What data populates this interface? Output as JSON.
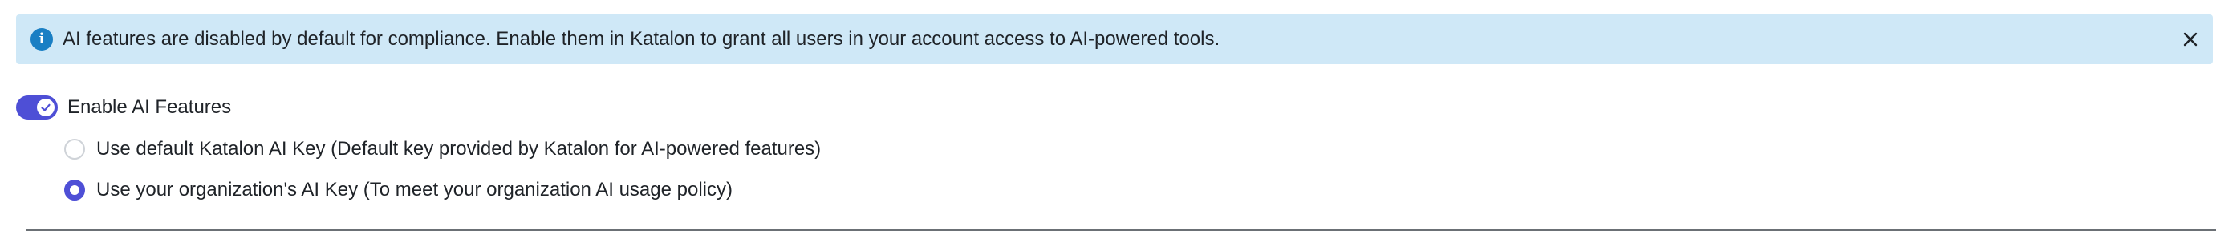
{
  "banner": {
    "text": "AI features are disabled by default for compliance. Enable them in Katalon to grant all users in your account access to AI-powered tools.",
    "icon": "info-icon",
    "close_icon": "close-icon",
    "background_color": "#cfe8f7",
    "icon_color": "#1a7fc4"
  },
  "ai_toggle": {
    "label": "Enable AI Features",
    "enabled": true,
    "accent_color": "#4e4fd6"
  },
  "ai_key_options": [
    {
      "label": "Use default Katalon AI Key (Default key provided by Katalon for AI-powered features)",
      "selected": false
    },
    {
      "label": "Use your organization's AI Key (To meet your organization AI usage policy)",
      "selected": true
    }
  ]
}
